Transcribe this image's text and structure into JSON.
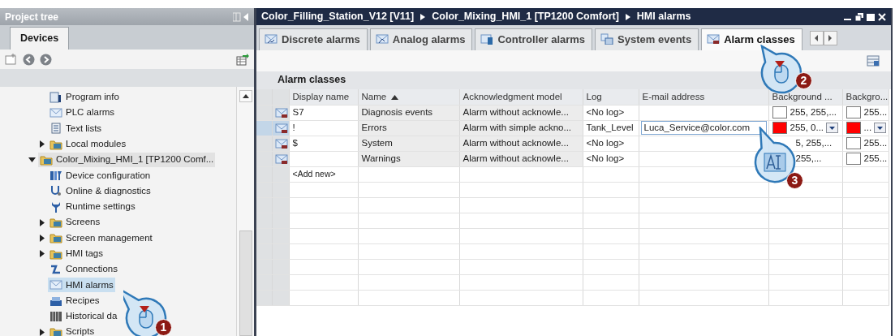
{
  "project_tree": {
    "title": "Project tree",
    "tabs": [
      {
        "label": "Devices",
        "selected": true
      }
    ],
    "tree": {
      "upper_items": [
        {
          "label": "Program info",
          "kind": "info",
          "selected": false
        },
        {
          "label": "PLC alarms",
          "kind": "mail",
          "selected": false
        },
        {
          "label": "Text lists",
          "kind": "document",
          "selected": false
        },
        {
          "label": "Local modules",
          "kind": "folder",
          "expanded": false,
          "selected": false
        }
      ],
      "nodes": [
        {
          "label": "Color_Mixing_HMI_1 [TP1200 Comf...",
          "kind": "folder",
          "expanded": true,
          "selected": false,
          "current": true,
          "children": [
            {
              "label": "Device configuration",
              "kind": "device",
              "selected": false
            },
            {
              "label": "Online & diagnostics",
              "kind": "diagnostics",
              "selected": false
            },
            {
              "label": "Runtime settings",
              "kind": "wrench",
              "selected": false
            },
            {
              "label": "Screens",
              "kind": "folder",
              "expanded": false,
              "selected": false
            },
            {
              "label": "Screen management",
              "kind": "folder",
              "expanded": false,
              "selected": false
            },
            {
              "label": "HMI tags",
              "kind": "folder",
              "expanded": false,
              "selected": false
            },
            {
              "label": "Connections",
              "kind": "connection",
              "selected": false
            },
            {
              "label": "HMI alarms",
              "kind": "mail",
              "selected": true
            },
            {
              "label": "Recipes",
              "kind": "recipe",
              "selected": false
            },
            {
              "label": "Historical da",
              "kind": "archive",
              "selected": false
            },
            {
              "label": "Scripts",
              "kind": "folder",
              "expanded": false,
              "selected": false
            }
          ]
        }
      ]
    }
  },
  "editor": {
    "breadcrumb": [
      "Color_Filling_Station_V12 [V11]",
      "Color_Mixing_HMI_1 [TP1200 Comfort]",
      "HMI alarms"
    ],
    "tabs": [
      {
        "label": "Discrete alarms",
        "selected": false
      },
      {
        "label": "Analog alarms",
        "selected": false
      },
      {
        "label": "Controller alarms",
        "selected": false
      },
      {
        "label": "System events",
        "selected": false
      },
      {
        "label": "Alarm classes",
        "selected": true
      }
    ],
    "section_title": "Alarm classes",
    "table": {
      "columns": [
        {
          "label": "Display name",
          "sorted": false
        },
        {
          "label": "Name",
          "sorted": true
        },
        {
          "label": "Acknowledgment model",
          "sorted": false
        },
        {
          "label": "Log",
          "sorted": false
        },
        {
          "label": "E-mail address",
          "sorted": false
        },
        {
          "label": "Background ...",
          "sorted": false
        },
        {
          "label": "Backgro...",
          "sorted": false
        }
      ],
      "rows": [
        {
          "display_name": "S7",
          "name": "Diagnosis events",
          "acknowledgment": "Alarm without acknowle...",
          "log": "<No log>",
          "background": {
            "color": "#ffffff",
            "text": "255, 255,..."
          },
          "background_2": {
            "color": "#ffffff",
            "text": "255..."
          },
          "selected": false,
          "editing": false
        },
        {
          "display_name": "!",
          "name": "Errors",
          "acknowledgment": "Alarm with simple ackno...",
          "log": "Tank_Level",
          "email": "Luca_Service@color.com",
          "background": {
            "color": "#ff0000",
            "text": "255, 0..."
          },
          "background_2": {
            "color": "#ff0000",
            "text": "..."
          },
          "selected": true,
          "editing": true
        },
        {
          "display_name": "$",
          "name": "System",
          "acknowledgment": "Alarm without acknowle...",
          "log": "<No log>",
          "background": {
            "text": "5, 255,..."
          },
          "background_2": {
            "color": "#ffffff",
            "text": "255..."
          },
          "selected": false,
          "editing": false
        },
        {
          "name": "Warnings",
          "acknowledgment": "Alarm without acknowle...",
          "log": "<No log>",
          "background": {
            "text": "255,..."
          },
          "background_2": {
            "color": "#ffffff",
            "text": "255..."
          },
          "selected": false,
          "editing": false
        }
      ],
      "add_new": "<Add new>"
    }
  },
  "callouts": [
    {
      "number": "1",
      "kind": "mouse"
    },
    {
      "number": "2",
      "kind": "mouse"
    },
    {
      "number": "3",
      "kind": "text"
    }
  ]
}
